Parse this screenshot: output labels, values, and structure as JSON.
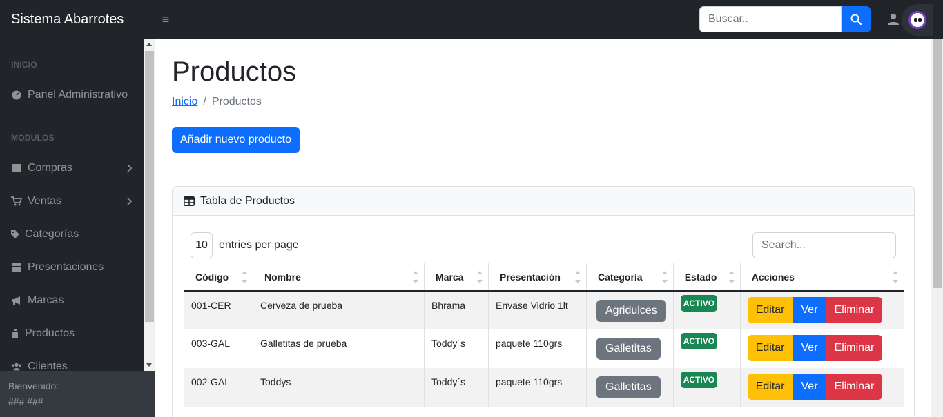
{
  "app": {
    "brand": "Sistema Abarrotes"
  },
  "topbar": {
    "search_placeholder": "Buscar.."
  },
  "sidebar": {
    "sections": [
      {
        "heading": "INICIO"
      },
      {
        "heading": "MODULOS"
      }
    ],
    "items": [
      {
        "label": "Panel Administrativo",
        "icon": "tachometer-icon"
      },
      {
        "label": "Compras",
        "icon": "store-icon",
        "has_submenu": true
      },
      {
        "label": "Ventas",
        "icon": "cart-icon",
        "has_submenu": true
      },
      {
        "label": "Categorías",
        "icon": "tag-icon"
      },
      {
        "label": "Presentaciones",
        "icon": "box-icon"
      },
      {
        "label": "Marcas",
        "icon": "megaphone-icon"
      },
      {
        "label": "Productos",
        "icon": "bottle-icon"
      },
      {
        "label": "Clientes",
        "icon": "users-icon"
      }
    ],
    "footer": {
      "welcome": "Bienvenido:",
      "user": "### ###"
    }
  },
  "page": {
    "title": "Productos",
    "breadcrumb": {
      "home": "Inicio",
      "separator": "/",
      "current": "Productos"
    },
    "add_button": "Añadir nuevo producto"
  },
  "card": {
    "title": "Tabla de Productos",
    "per_page_value": "10",
    "per_page_label": "entries per page",
    "search_placeholder": "Search..."
  },
  "table": {
    "columns": [
      "Código",
      "Nombre",
      "Marca",
      "Presentación",
      "Categoría",
      "Estado",
      "Acciones"
    ],
    "rows": [
      {
        "codigo": "001-CER",
        "nombre": "Cerveza de prueba",
        "marca": "Bhrama",
        "presentacion": "Envase Vidrio 1lt",
        "categoria": "Agridulces",
        "estado": "ACTIVO"
      },
      {
        "codigo": "003-GAL",
        "nombre": "Galletitas de prueba",
        "marca": "Toddy´s",
        "presentacion": "paquete 110grs",
        "categoria": "Galletitas",
        "estado": "ACTIVO"
      },
      {
        "codigo": "002-GAL",
        "nombre": "Toddys",
        "marca": "Toddy´s",
        "presentacion": "paquete 110grs",
        "categoria": "Galletitas",
        "estado": "ACTIVO"
      }
    ],
    "actions": {
      "edit": "Editar",
      "view": "Ver",
      "delete": "Eliminar"
    }
  },
  "colors": {
    "dark": "#212529",
    "primary": "#0d6efd",
    "warning": "#ffc107",
    "danger": "#dc3545",
    "success": "#198754",
    "secondary": "#6c757d"
  }
}
